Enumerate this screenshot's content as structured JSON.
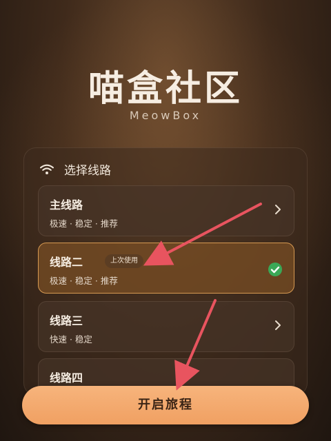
{
  "app": {
    "title": "喵盒社区",
    "subtitle": "MeowBox"
  },
  "route_picker": {
    "header": "选择线路",
    "header_icon": "wifi-icon",
    "routes": [
      {
        "name": "主线路",
        "desc": "极速 · 稳定 · 推荐",
        "badge": "",
        "selected": false,
        "icon": "chevron-right-icon"
      },
      {
        "name": "线路二",
        "desc": "极速 · 稳定 · 推荐",
        "badge": "上次使用",
        "selected": true,
        "icon": "check-circle-icon"
      },
      {
        "name": "线路三",
        "desc": "快速 · 稳定",
        "badge": "",
        "selected": false,
        "icon": "chevron-right-icon"
      },
      {
        "name": "线路四",
        "desc": "",
        "badge": "",
        "selected": false,
        "icon": ""
      }
    ]
  },
  "actions": {
    "start_label": "开启旅程"
  },
  "colors": {
    "accent": "#f0a062",
    "selected_border": "#d79a52",
    "check_green": "#3aa857",
    "annotation_arrow": "#e8545f"
  }
}
